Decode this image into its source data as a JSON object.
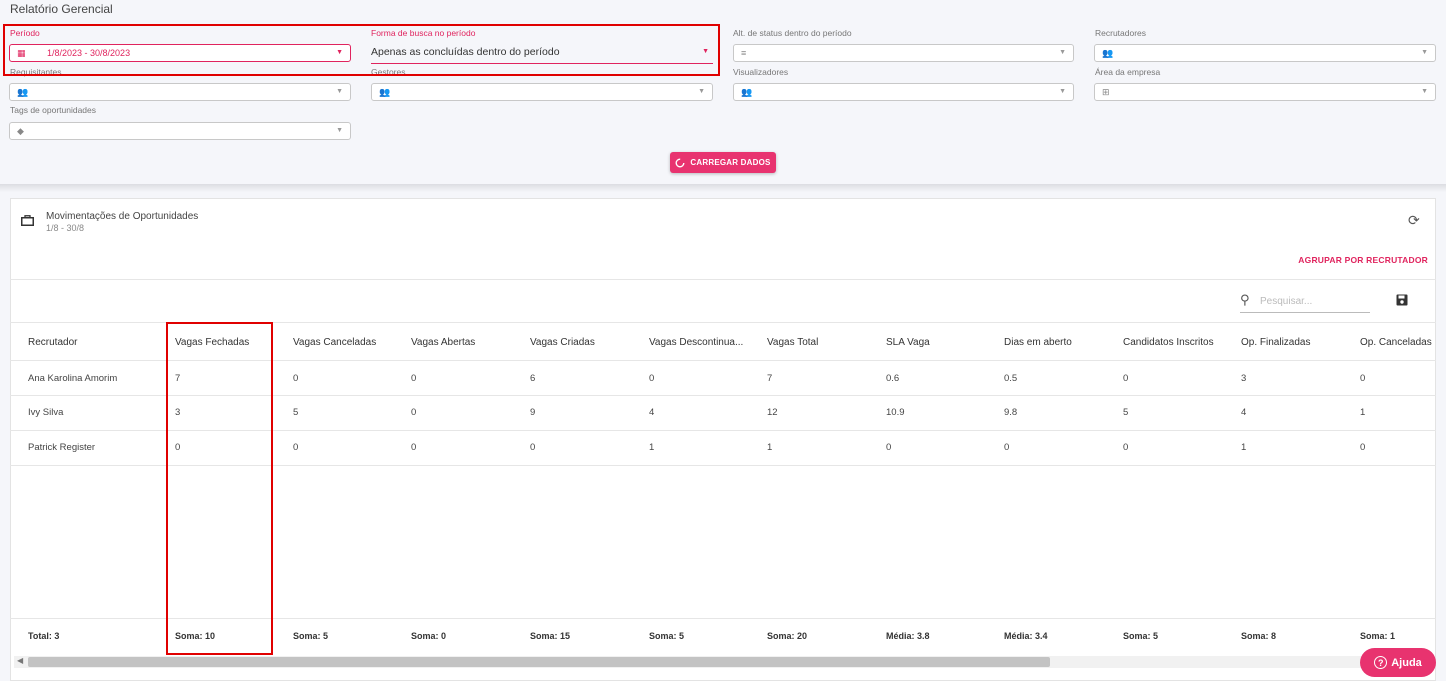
{
  "page": {
    "title": "Relatório Gerencial"
  },
  "filters": {
    "periodo": {
      "label": "Período",
      "value": "1/8/2023 - 30/8/2023"
    },
    "forma_busca": {
      "label": "Forma de busca no período",
      "value": "Apenas as concluídas dentro do período"
    },
    "alt_status": {
      "label": "Alt. de status dentro do período"
    },
    "recrutadores": {
      "label": "Recrutadores"
    },
    "requisitantes": {
      "label": "Requisitantes"
    },
    "gestores": {
      "label": "Gestores"
    },
    "visualizadores": {
      "label": "Visualizadores"
    },
    "area_empresa": {
      "label": "Área da empresa"
    },
    "tags": {
      "label": "Tags de oportunidades"
    }
  },
  "load_button": {
    "label": "CARREGAR DADOS"
  },
  "card": {
    "title": "Movimentações de Oportunidades",
    "subtitle": "1/8 - 30/8",
    "group_link": "AGRUPAR POR RECRUTADOR",
    "search_placeholder": "Pesquisar..."
  },
  "table": {
    "columns": [
      "Recrutador",
      "Vagas Fechadas",
      "Vagas Canceladas",
      "Vagas Abertas",
      "Vagas Criadas",
      "Vagas Descontinua...",
      "Vagas Total",
      "SLA Vaga",
      "Dias em aberto",
      "Candidatos Inscritos",
      "Op. Finalizadas",
      "Op. Canceladas"
    ],
    "rows": [
      [
        "Ana Karolina Amorim",
        "7",
        "0",
        "0",
        "6",
        "0",
        "7",
        "0.6",
        "0.5",
        "0",
        "3",
        "0"
      ],
      [
        "Ivy Silva",
        "3",
        "5",
        "0",
        "9",
        "4",
        "12",
        "10.9",
        "9.8",
        "5",
        "4",
        "1"
      ],
      [
        "Patrick Register",
        "0",
        "0",
        "0",
        "0",
        "1",
        "1",
        "0",
        "0",
        "0",
        "1",
        "0"
      ]
    ],
    "footer": [
      "Total: 3",
      "Soma: 10",
      "Soma: 5",
      "Soma: 0",
      "Soma: 15",
      "Soma: 5",
      "Soma: 20",
      "Média: 3.8",
      "Média: 3.4",
      "Soma: 5",
      "Soma: 8",
      "Soma: 1"
    ]
  },
  "help_button": {
    "label": "Ajuda"
  },
  "colors": {
    "accent": "#e0245e",
    "button": "#e8336f",
    "highlight": "#e00000"
  }
}
